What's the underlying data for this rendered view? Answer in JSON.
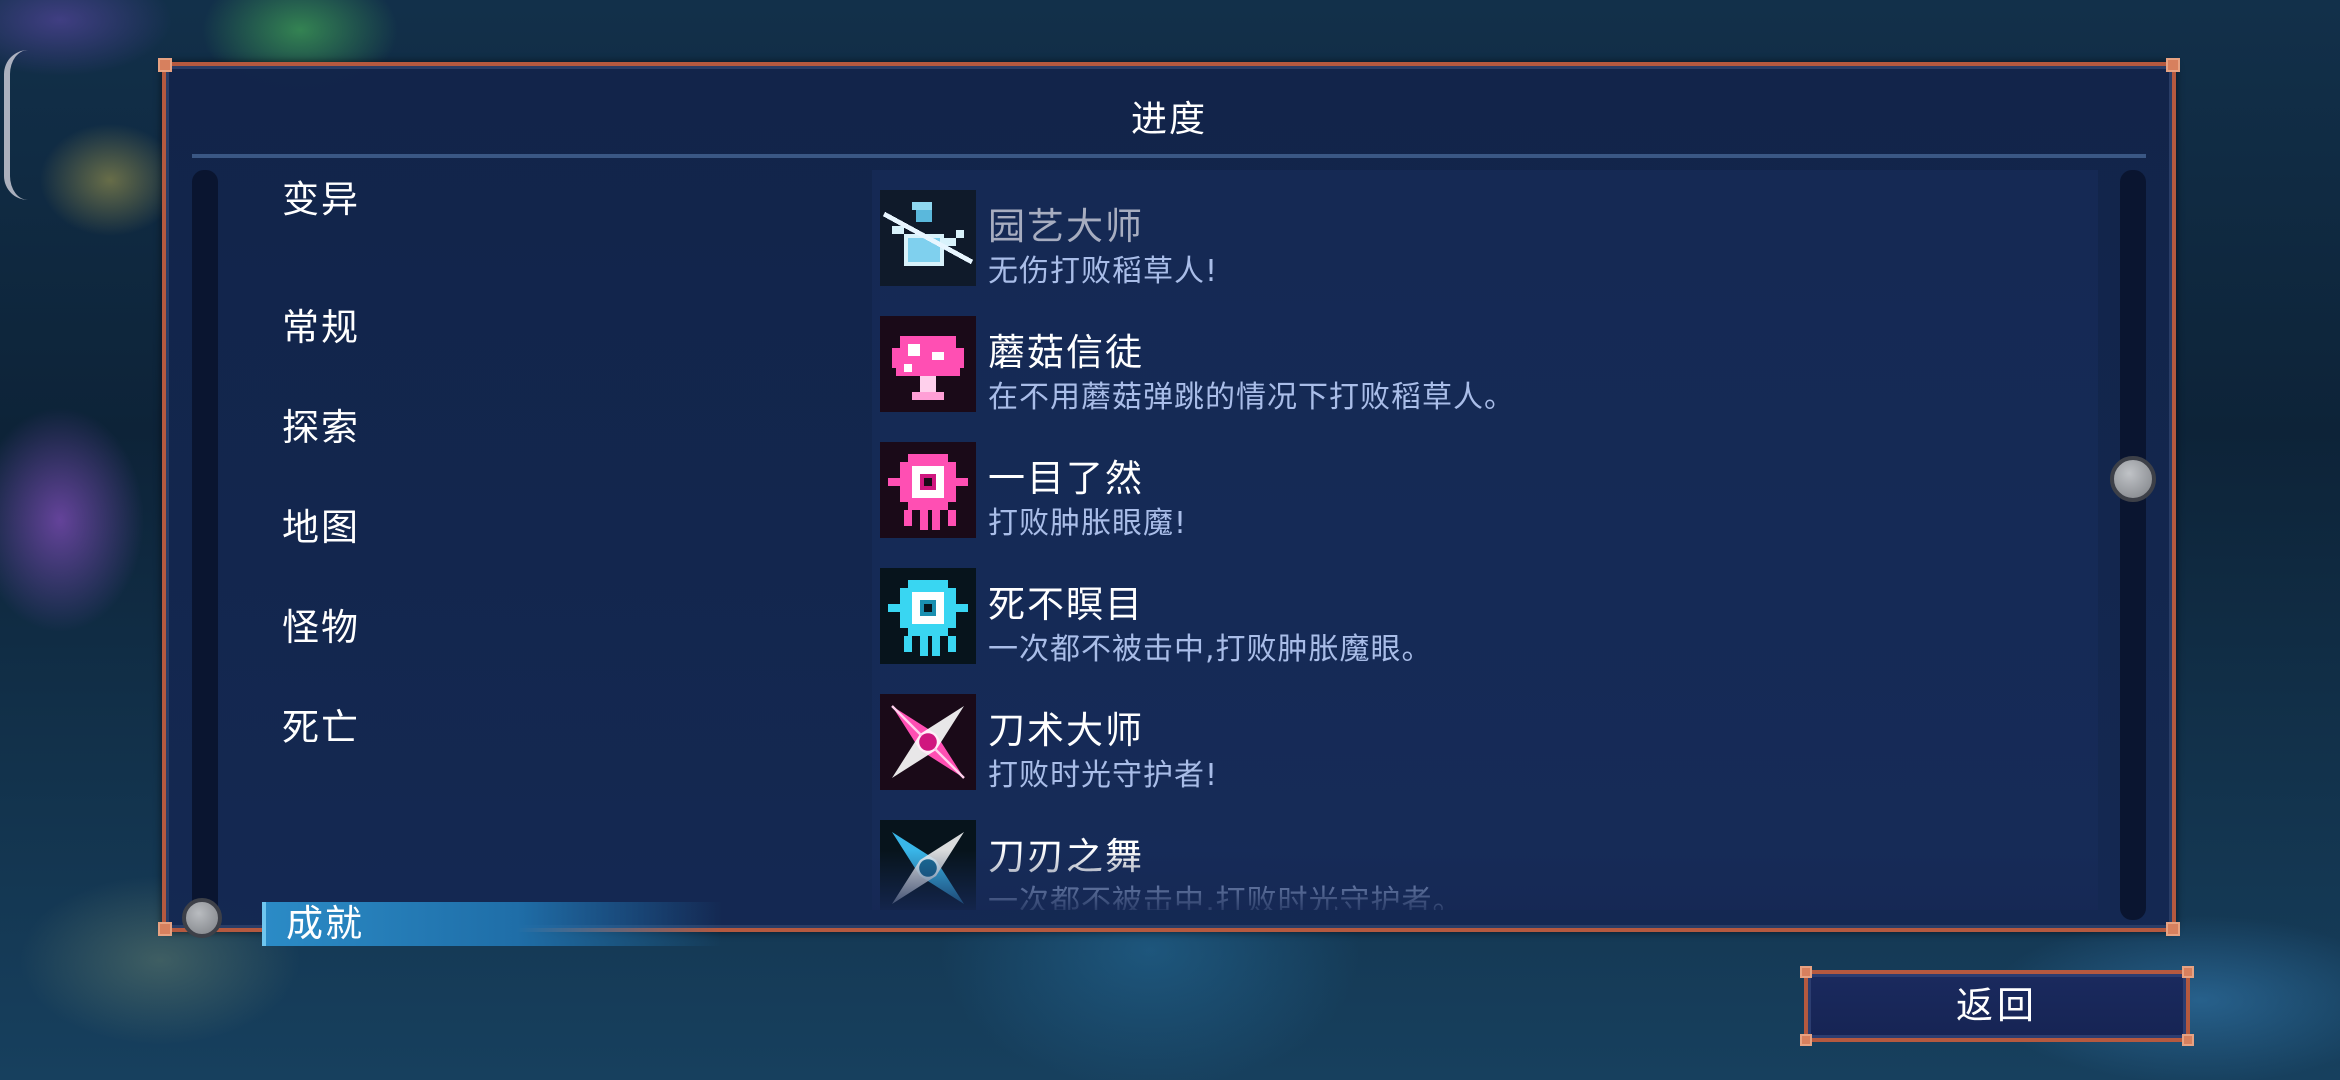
{
  "panel": {
    "title": "进度"
  },
  "categories": [
    {
      "label": "变异",
      "active": false
    },
    {
      "label": "常规",
      "active": false
    },
    {
      "label": "探索",
      "active": false
    },
    {
      "label": "地图",
      "active": false
    },
    {
      "label": "怪物",
      "active": false
    },
    {
      "label": "死亡",
      "active": false
    },
    {
      "label": "成就",
      "active": true
    }
  ],
  "achievements": [
    {
      "name": "园艺大师",
      "description": "无伤打败稻草人!",
      "icon": "watering-can-icon",
      "unlocked": false
    },
    {
      "name": "蘑菇信徒",
      "description": "在不用蘑菇弹跳的情况下打败稻草人。",
      "icon": "mushroom-icon",
      "unlocked": true
    },
    {
      "name": "一目了然",
      "description": "打败肿胀眼魔!",
      "icon": "pink-eyeball-monster-icon",
      "unlocked": true
    },
    {
      "name": "死不瞑目",
      "description": "一次都不被击中,打败肿胀魔眼。",
      "icon": "cyan-eyeball-monster-icon",
      "unlocked": true
    },
    {
      "name": "刀术大师",
      "description": "打败时光守护者!",
      "icon": "pink-shuriken-icon",
      "unlocked": true
    },
    {
      "name": "刀刃之舞",
      "description": "一次都不被击中,打败时光守护者。",
      "icon": "blue-shuriken-icon",
      "unlocked": true
    }
  ],
  "buttons": {
    "back_label": "返回"
  },
  "colors": {
    "frame_border": "#b5593f",
    "panel_bg": "#12244a",
    "active_tab": "#2b8bc6",
    "description_text": "#a9bde8"
  }
}
